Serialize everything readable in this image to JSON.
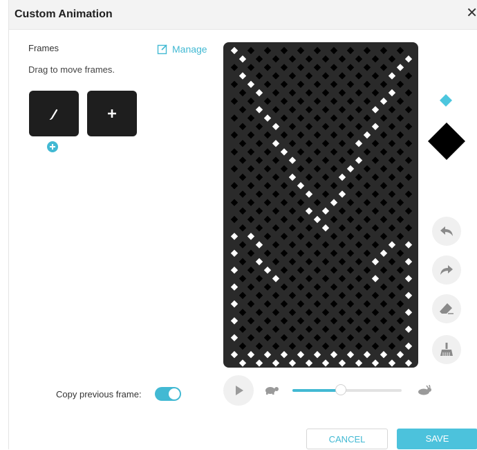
{
  "dialog": {
    "title": "Custom Animation",
    "close_glyph": "✕"
  },
  "frames": {
    "label": "Frames",
    "manage_label": "Manage",
    "manage_icon": "edit-icon",
    "hint": "Drag to move frames.",
    "tiles": [
      {
        "icon": "brush-icon"
      },
      {
        "icon": "plus-icon",
        "glyph": "+"
      }
    ],
    "add_icon": "add-circle-icon"
  },
  "canvas": {
    "background": "#2a2a2a",
    "pixel_on": "#ffffff",
    "pixel_off": "#000000",
    "pattern": "X shape: two diagonal bands cross near the top, then diverge into a V-shaped outline along the sides and bottom"
  },
  "tools": {
    "brush_colors": [
      "#4cc6de",
      "#000000"
    ],
    "buttons": [
      "undo-icon",
      "redo-icon",
      "eraser-icon",
      "clear-broom-icon"
    ]
  },
  "playback": {
    "copy_previous_label": "Copy previous frame:",
    "copy_previous_enabled": true,
    "speed_fraction": 0.44,
    "slow_icon": "turtle-icon",
    "fast_icon": "rabbit-icon"
  },
  "footer": {
    "cancel_label": "CANCEL",
    "save_label": "SAVE"
  },
  "colors": {
    "accent": "#42b9d3"
  }
}
